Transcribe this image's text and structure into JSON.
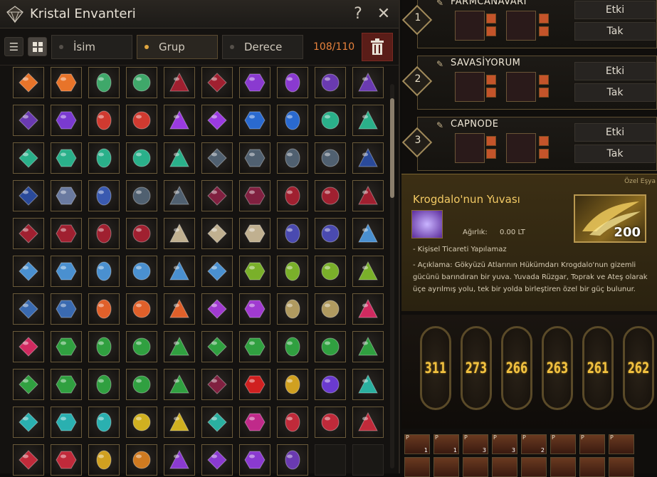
{
  "window": {
    "title": "Kristal Envanteri",
    "help": "?",
    "close": "✕"
  },
  "toolbar": {
    "sort_name": "İsim",
    "sort_group": "Grup",
    "sort_grade": "Derece",
    "count": "108/110"
  },
  "gem_colors": [
    "#e8742a",
    "#e8742a",
    "#3fa86a",
    "#3fa86a",
    "#a02030",
    "#a02030",
    "#8a3ad0",
    "#8a3ad0",
    "#6a3ab0",
    "#6a3ab0",
    "#6a3ab0",
    "#7a3ad0",
    "#d03a30",
    "#d03a30",
    "#9a3ae0",
    "#9a3ae0",
    "#2a6ad0",
    "#2a6ad0",
    "#2ab08a",
    "#2ab08a",
    "#2ab08a",
    "#2ab08a",
    "#2ab08a",
    "#2ab08a",
    "#2ab08a",
    "#506070",
    "#506070",
    "#506070",
    "#506070",
    "#2a4a9a",
    "#2a4a9a",
    "#6a7aa0",
    "#3a5ab0",
    "#506070",
    "#506070",
    "#802040",
    "#802040",
    "#a02030",
    "#a02030",
    "#a02030",
    "#a02030",
    "#a02030",
    "#a02030",
    "#a02030",
    "#c0b090",
    "#c0b090",
    "#c0b090",
    "#4a4ab0",
    "#4a4ab0",
    "#4a90d0",
    "#4a90d0",
    "#4a90d0",
    "#4a90d0",
    "#4a90d0",
    "#4a90d0",
    "#4a90d0",
    "#7ab02a",
    "#7ab02a",
    "#7ab02a",
    "#7ab02a",
    "#3a6ab0",
    "#3a6ab0",
    "#e0602a",
    "#e0602a",
    "#e0602a",
    "#a03ad0",
    "#a03ad0",
    "#b09a60",
    "#b09a60",
    "#d02a60",
    "#d02a60",
    "#30a040",
    "#30a040",
    "#30a040",
    "#30a040",
    "#30a040",
    "#30a040",
    "#30a040",
    "#30a040",
    "#30a040",
    "#30a040",
    "#30a040",
    "#30a040",
    "#30a040",
    "#30a040",
    "#802040",
    "#d02020",
    "#d0a020",
    "#6a3ad0",
    "#2ab0a0",
    "#2ab0b0",
    "#2ab0b0",
    "#2ab0b0",
    "#d0b020",
    "#d0b020",
    "#2ab0a0",
    "#c02a8a",
    "#c02a3a",
    "#c02a3a",
    "#c02a3a",
    "#c02a3a",
    "#c02a3a",
    "#d0a020",
    "#d07a20",
    "#8a3ad0",
    "#8a3ad0",
    "#8a3ad0",
    "#6a3ab0"
  ],
  "teams": [
    {
      "number": "1",
      "name": "FARMCANAVARI",
      "btn1": "Etki",
      "btn2": "Tak"
    },
    {
      "number": "2",
      "name": "SAVASİYORUM",
      "btn1": "Etki",
      "btn2": "Tak"
    },
    {
      "number": "3",
      "name": "CAPNODE",
      "btn1": "Etki",
      "btn2": "Tak"
    }
  ],
  "tooltip": {
    "special": "Özel Eşya",
    "item_name": "Krogdalo'nun Yuvası",
    "weight_label": "Ağırlık:",
    "weight_value": "0.00 LT",
    "quantity": "200",
    "trade": "- Kişisel Ticareti Yapılamaz",
    "description": "- Açıklama: Gökyüzü Atlarının Hükümdarı Krogdalo'nun gizemli gücünü barındıran bir yuva. Yuvada Rüzgar, Toprak ve Ateş olarak üçe ayrılmış yolu, tek bir yolda birleştiren özel bir güç bulunur."
  },
  "scores": [
    "311",
    "273",
    "266",
    "263",
    "261",
    "262"
  ],
  "hotbar": [
    {
      "p": "P",
      "n": "1"
    },
    {
      "p": "P",
      "n": "1"
    },
    {
      "p": "P",
      "n": "3"
    },
    {
      "p": "P",
      "n": "3"
    },
    {
      "p": "P",
      "n": "2"
    },
    {
      "p": "P",
      "n": ""
    },
    {
      "p": "P",
      "n": ""
    },
    {
      "p": "P",
      "n": ""
    }
  ]
}
